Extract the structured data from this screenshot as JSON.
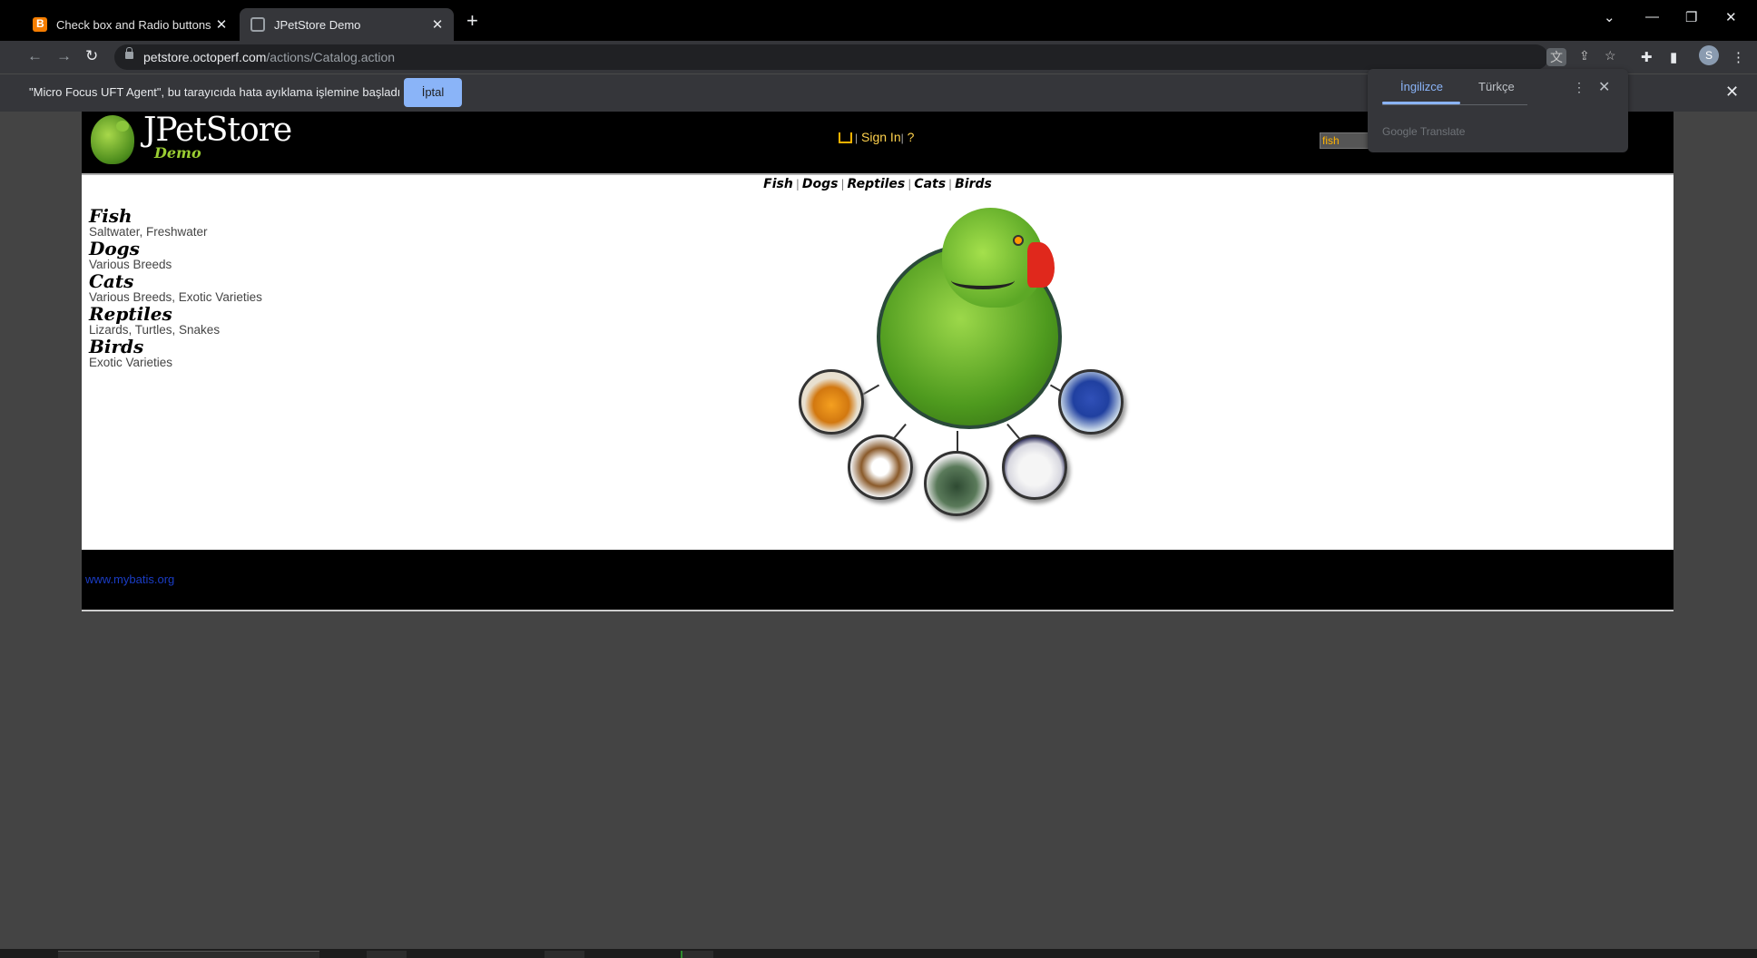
{
  "browser": {
    "tabs": [
      {
        "title": "Check box and Radio buttons",
        "icon": "blogger-icon",
        "active": false
      },
      {
        "title": "JPetStore Demo",
        "icon": "globe-icon",
        "active": true
      }
    ],
    "url_host": "petstore.octoperf.com",
    "url_path": "/actions/Catalog.action",
    "profile_initial": "S"
  },
  "infobar": {
    "message": "\"Micro Focus UFT Agent\", bu tarayıcıda hata ayıklama işlemine başladı",
    "button": "İptal"
  },
  "translate": {
    "tab_source": "İngilizce",
    "tab_target": "Türkçe",
    "footer": "Google Translate"
  },
  "store": {
    "logo_title": "JPetStore",
    "logo_subtitle": "Demo",
    "menu": {
      "sign_in": "Sign In",
      "help": "?",
      "sep": "|"
    },
    "search_value": "fish",
    "quicklinks": [
      "Fish",
      "Dogs",
      "Reptiles",
      "Cats",
      "Birds"
    ],
    "categories": [
      {
        "name": "Fish",
        "desc": "Saltwater, Freshwater"
      },
      {
        "name": "Dogs",
        "desc": "Various Breeds"
      },
      {
        "name": "Cats",
        "desc": "Various Breeds, Exotic Varieties"
      },
      {
        "name": "Reptiles",
        "desc": "Lizards, Turtles, Snakes"
      },
      {
        "name": "Birds",
        "desc": "Exotic Varieties"
      }
    ],
    "footer_link": "www.mybatis.org"
  },
  "colors": {
    "page_bg": "#444444",
    "header_bg": "#000000",
    "menu_gold": "#ffd24d",
    "accent_blue": "#8ab4f8"
  }
}
